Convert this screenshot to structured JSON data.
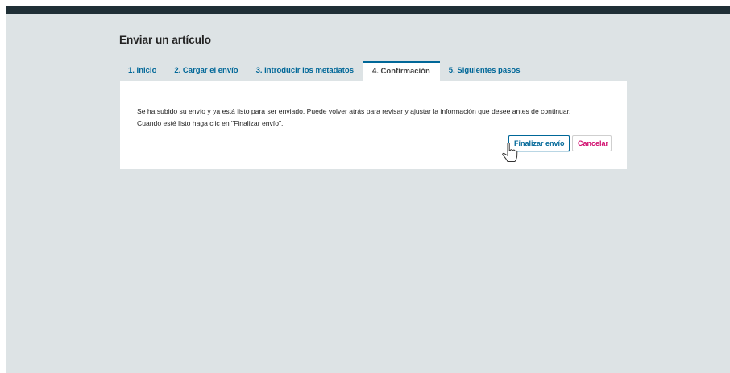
{
  "page": {
    "title": "Enviar un artículo"
  },
  "tabs": [
    {
      "label": "1. Inicio",
      "active": false
    },
    {
      "label": "2. Cargar el envío",
      "active": false
    },
    {
      "label": "3. Introducir los metadatos",
      "active": false
    },
    {
      "label": "4. Confirmación",
      "active": true
    },
    {
      "label": "5. Siguientes pasos",
      "active": false
    }
  ],
  "confirmation": {
    "message_line1": "Se ha subido su envío y ya está listo para ser enviado. Puede volver atrás para revisar y ajustar la información que desee antes de continuar.",
    "message_line2": "Cuando esté listo haga clic en \"Finalizar envío\".",
    "finish_label": "Finalizar envío",
    "cancel_label": "Cancelar"
  },
  "colors": {
    "accent": "#006798",
    "cancel": "#d00a6c",
    "topbar": "#1f2f36",
    "background": "#dde3e5"
  },
  "icons": {
    "cursor": "hand-pointer-icon"
  }
}
